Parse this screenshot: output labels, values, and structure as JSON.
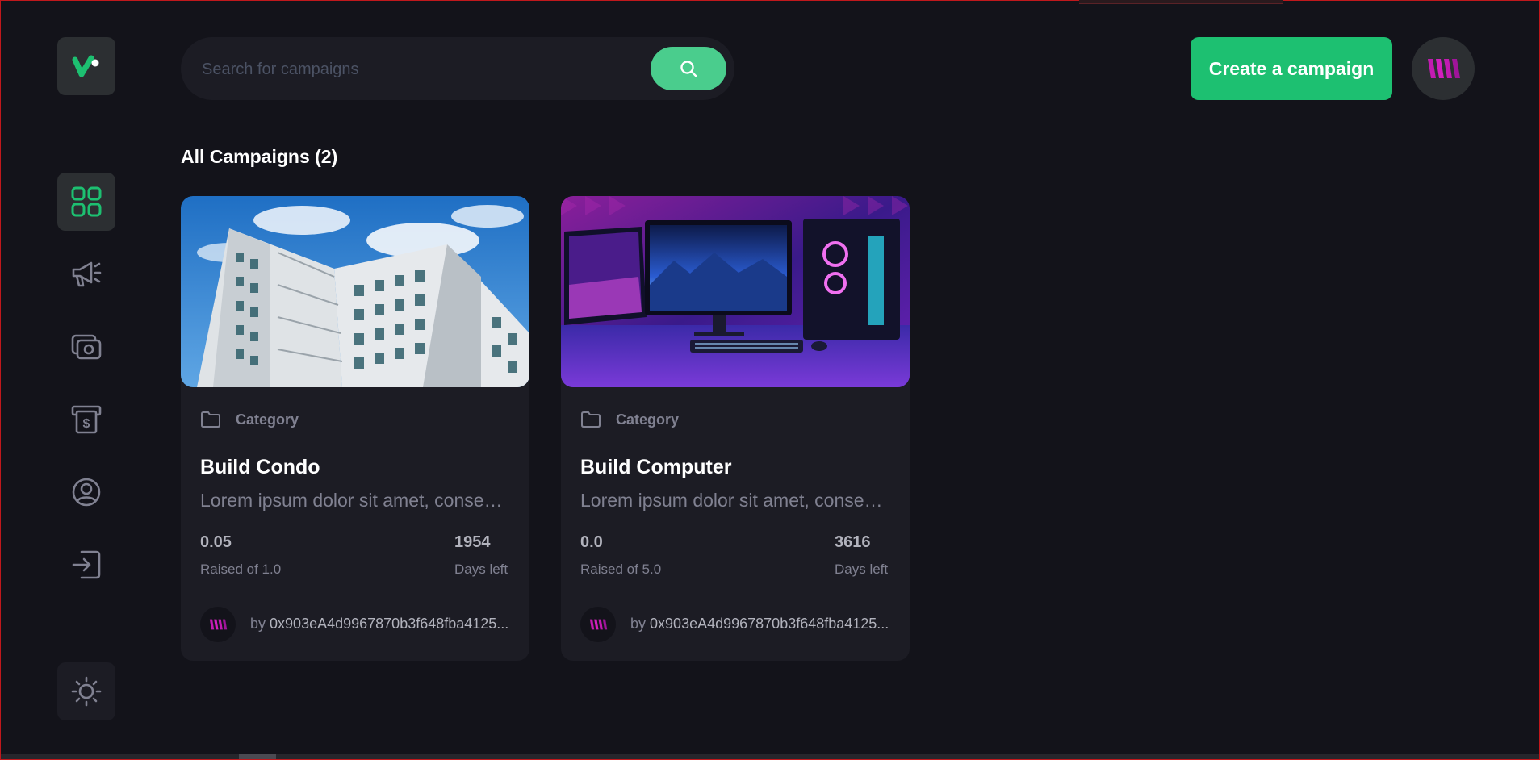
{
  "colors": {
    "background": "#13131a",
    "surface": "#1c1c24",
    "accent": "#1dc071",
    "search_button": "#4acd8d",
    "muted_text": "#808191",
    "brand_magenta": "#c21bb1"
  },
  "sidebar": {
    "logo_icon": "logo-icon",
    "items": [
      {
        "name": "dashboard",
        "icon": "grid-icon",
        "active": true
      },
      {
        "name": "campaign",
        "icon": "megaphone-icon",
        "active": false
      },
      {
        "name": "payment",
        "icon": "payment-icon",
        "active": false
      },
      {
        "name": "withdraw",
        "icon": "withdraw-icon",
        "active": false
      },
      {
        "name": "profile",
        "icon": "user-icon",
        "active": false
      },
      {
        "name": "logout",
        "icon": "logout-icon",
        "active": false
      }
    ],
    "theme_icon": "sun-icon"
  },
  "header": {
    "search_placeholder": "Search for campaigns",
    "search_icon": "search-icon",
    "create_label": "Create a campaign",
    "avatar_icon": "brand-logo-icon"
  },
  "main": {
    "title": "All Campaigns (2)",
    "campaigns": [
      {
        "image": "condo-building-photo",
        "category": "Category",
        "title": "Build Condo",
        "description": "Lorem ipsum dolor sit amet, consectetur adipiscing elit",
        "raised": "0.05",
        "raised_label": "Raised of 1.0",
        "days": "1954",
        "days_label": "Days left",
        "owner_prefix": "by",
        "owner": "0x903eA4d9967870b3f648fba4125..."
      },
      {
        "image": "gaming-computer-photo",
        "category": "Category",
        "title": "Build Computer",
        "description": "Lorem ipsum dolor sit amet, consectetur adipiscing elit",
        "raised": "0.0",
        "raised_label": "Raised of 5.0",
        "days": "3616",
        "days_label": "Days left",
        "owner_prefix": "by",
        "owner": "0x903eA4d9967870b3f648fba4125..."
      }
    ]
  }
}
